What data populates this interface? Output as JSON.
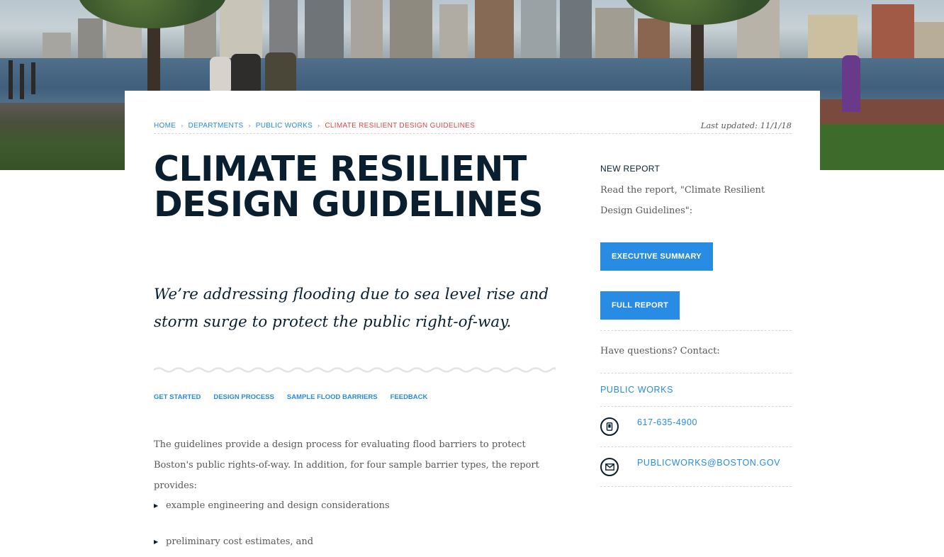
{
  "breadcrumb": {
    "items": [
      "Home",
      "Departments",
      "Public Works"
    ],
    "current": "Climate Resilient Design Guidelines",
    "last_updated": "Last updated: 11/1/18"
  },
  "page": {
    "title": "Climate Resilient Design Guidelines",
    "lede": "We’re addressing flooding due to sea level rise and storm surge to protect the public right-of-way."
  },
  "subnav": [
    "Get Started",
    "Design Process",
    "Sample Flood Barriers",
    "Feedback"
  ],
  "body": {
    "intro": "The guidelines provide a design process for evaluating flood barriers to protect Boston's public rights-of-way.  In addition, for four sample barrier types, the report provides:",
    "bullets": [
      "example engineering and design considerations",
      "preliminary cost estimates, and"
    ]
  },
  "sidebar": {
    "label": "New Report",
    "intro": "Read the report, \"Climate Resilient Design Guidelines\":",
    "exec_summary_label": "Executive Summary",
    "full_report_label": "Full Report",
    "questions": "Have questions? Contact:",
    "department": "Public Works",
    "phone": "617-635-4900",
    "email": "PUBLICWORKS@BOSTON.GOV"
  },
  "colors": {
    "link": "#288be4",
    "title": "#091f2f",
    "current_crumb": "#e04646",
    "button": "#288be4"
  }
}
